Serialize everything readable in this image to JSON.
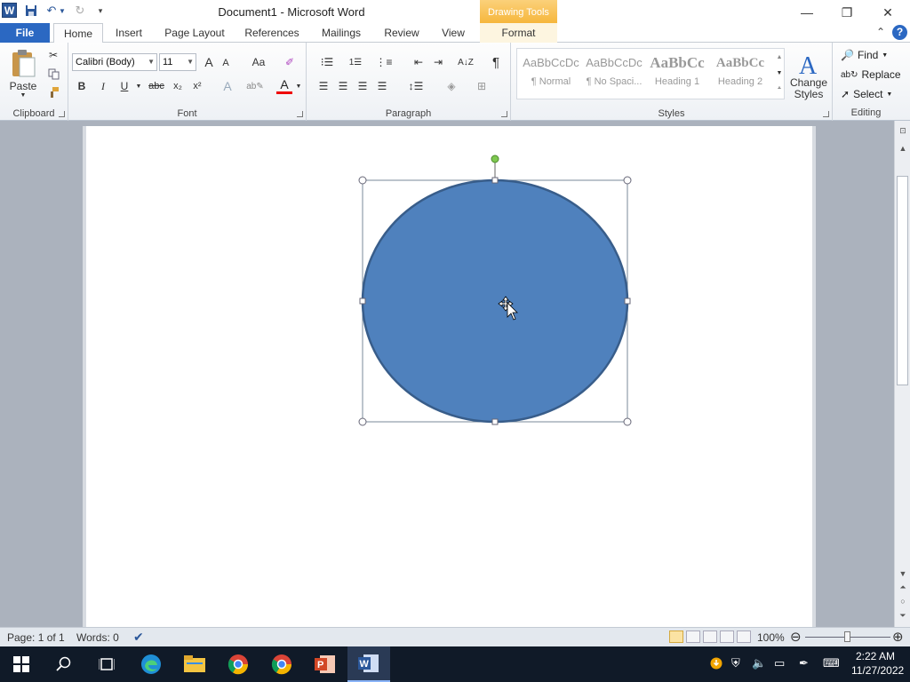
{
  "window": {
    "title": "Document1  -  Microsoft Word",
    "contextual_tab_group": "Drawing Tools",
    "app_icon_letter": "W",
    "controls": {
      "minimize": "—",
      "restore": "❐",
      "close": "✕"
    }
  },
  "tabs": {
    "file": "File",
    "home": "Home",
    "insert": "Insert",
    "page_layout": "Page Layout",
    "references": "References",
    "mailings": "Mailings",
    "review": "Review",
    "view": "View",
    "format": "Format"
  },
  "ribbon": {
    "clipboard": {
      "label": "Clipboard",
      "paste": "Paste"
    },
    "font": {
      "label": "Font",
      "font_name": "Calibri (Body)",
      "font_size": "11",
      "bold": "B",
      "italic": "I",
      "underline": "U",
      "strikethrough": "abc",
      "subscript": "x₂",
      "superscript": "x²",
      "grow": "A",
      "shrink": "A",
      "change_case": "Aa",
      "color": "A"
    },
    "paragraph": {
      "label": "Paragraph",
      "show_marks": "¶"
    },
    "styles": {
      "label": "Styles",
      "items": [
        {
          "sample": "AaBbCcDc",
          "name": "¶ Normal"
        },
        {
          "sample": "AaBbCcDc",
          "name": "¶ No Spaci..."
        },
        {
          "sample": "AaBbCc",
          "name": "Heading 1"
        },
        {
          "sample": "AaBbCc",
          "name": "Heading 2"
        }
      ],
      "change_styles": "Change Styles"
    },
    "editing": {
      "label": "Editing",
      "find": "Find",
      "replace": "Replace",
      "select": "Select"
    }
  },
  "status": {
    "page": "Page: 1 of 1",
    "words": "Words: 0",
    "zoom": "100%"
  },
  "colors": {
    "shape_fill": "#4f81bd",
    "shape_stroke": "#385d8a",
    "accent_blue": "#2b579a"
  },
  "taskbar": {
    "time": "2:22 AM",
    "date": "11/27/2022"
  }
}
